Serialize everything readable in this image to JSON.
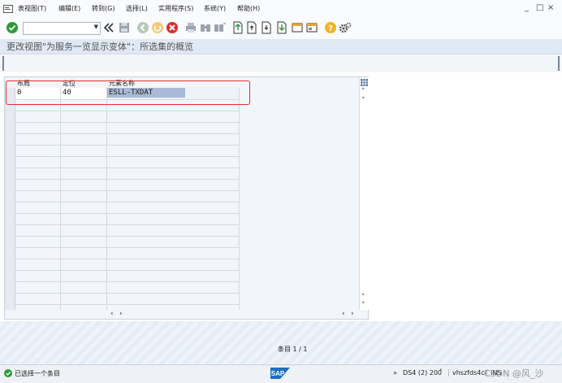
{
  "menu": {
    "items": [
      {
        "label": "表视图(T)"
      },
      {
        "label": "编辑(E)"
      },
      {
        "label": "转到(G)"
      },
      {
        "label": "选择(L)"
      },
      {
        "label": "实用程序(S)"
      },
      {
        "label": "系统(Y)"
      },
      {
        "label": "帮助(H)"
      }
    ],
    "window_controls": {
      "minimize": "_",
      "restore": "□",
      "close": "×"
    }
  },
  "toolbar": {
    "command_field_value": "",
    "icons": [
      "check-icon",
      "back-double-arrow-icon",
      "save-icon",
      "back-icon",
      "exit-icon",
      "cancel-icon",
      "print-icon",
      "find-icon",
      "find-next-icon",
      "first-page-icon",
      "previous-page-icon",
      "next-page-icon",
      "last-page-icon",
      "new-session-icon",
      "shortcut-icon",
      "help-icon",
      "settings-icon"
    ]
  },
  "page": {
    "title": "更改视图\"为服务一览显示变体\"：所选集的概览"
  },
  "table": {
    "columns": [
      "布局",
      "定位",
      "元素名称"
    ],
    "rows": [
      {
        "layout": "0",
        "position": "40",
        "element": "ESLL-TXDAT"
      }
    ],
    "empty_rows": 17
  },
  "footer": {
    "entry_label": "条目 1 / 1"
  },
  "statusbar": {
    "message": "已选择一个条目",
    "system": "DS4 (2) 200",
    "server": "vhszfds4ci",
    "mode": "INS",
    "watermark": "CSDN @风_沙",
    "expand": "»",
    "brand": "SAP"
  },
  "colors": {
    "accent_red": "#e23131",
    "selection": "#a9b9d6",
    "check_green": "#2e9a3a",
    "help_yellow": "#f2b420"
  }
}
